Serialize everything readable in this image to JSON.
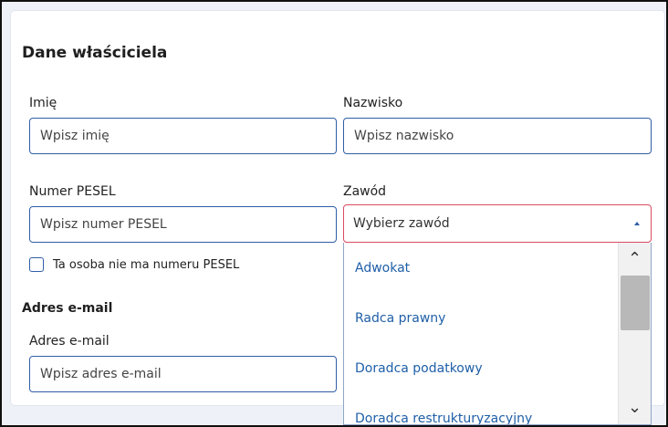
{
  "section": {
    "title": "Dane właściciela"
  },
  "fields": {
    "first_name": {
      "label": "Imię",
      "placeholder": "Wpisz imię"
    },
    "last_name": {
      "label": "Nazwisko",
      "placeholder": "Wpisz nazwisko"
    },
    "pesel": {
      "label": "Numer PESEL",
      "placeholder": "Wpisz numer PESEL"
    },
    "pesel_checkbox": {
      "label": "Ta osoba nie ma numeru PESEL"
    },
    "occupation": {
      "label": "Zawód",
      "value": "Wybierz zawód",
      "options": [
        "Adwokat",
        "Radca prawny",
        "Doradca podatkowy",
        "Doradca restrukturyzacyjny"
      ]
    },
    "email_section": {
      "heading": "Adres e-mail"
    },
    "email": {
      "label": "Adres e-mail",
      "placeholder": "Wpisz adres e-mail"
    }
  },
  "icons": {
    "caret": "caret-up-icon",
    "scroll_up": "chevron-up-icon",
    "scroll_down": "chevron-down-icon"
  },
  "colors": {
    "accent": "#2f5ea8",
    "error_border": "#d94b61",
    "option_text": "#1f5fa8"
  }
}
